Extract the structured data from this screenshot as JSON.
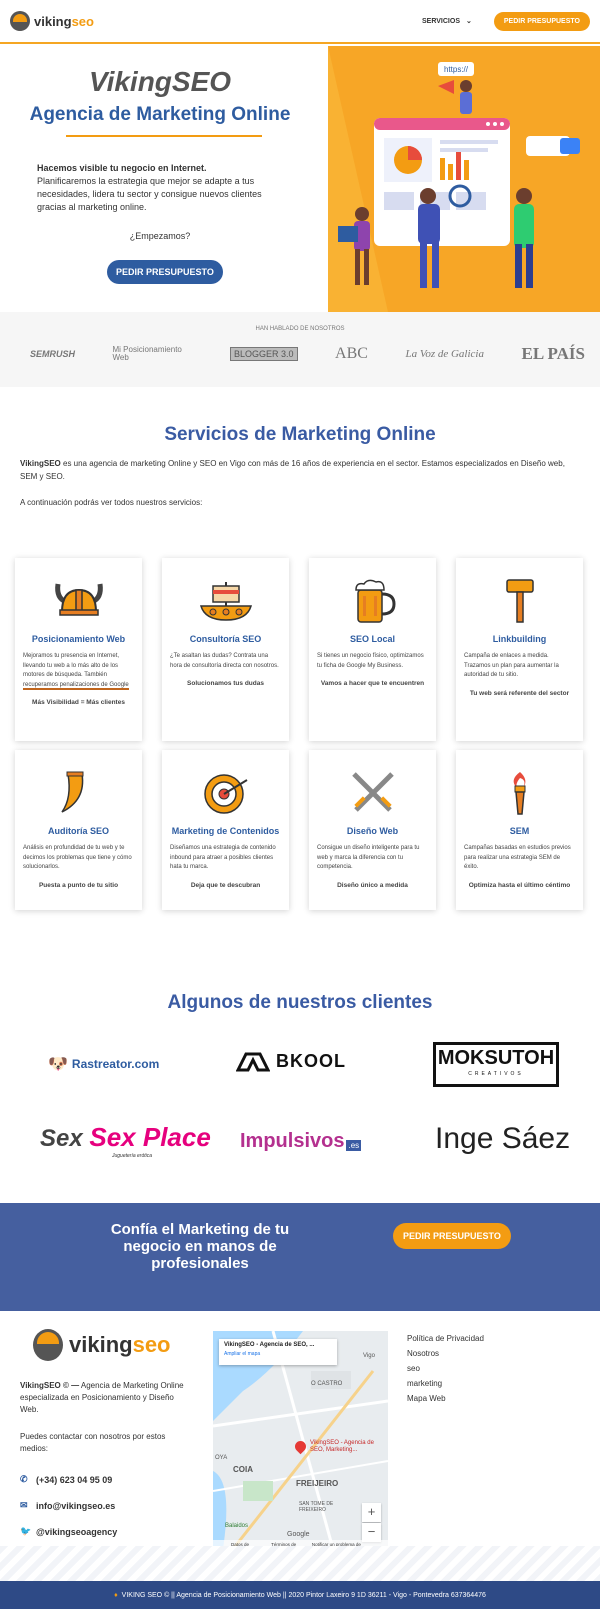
{
  "header": {
    "logo_text_a": "viking",
    "logo_text_b": "seo",
    "nav_servicios": "SERVICIOS",
    "nav_button": "PEDIR PRESUPUESTO"
  },
  "hero": {
    "title": "VikingSEO",
    "subtitle": "Agencia de Marketing Online",
    "lead_bold": "Hacemos visible tu negocio en Internet.",
    "lead": "Planificaremos la estrategia que mejor se adapte a tus necesidades, lidera tu sector y consigue nuevos clientes gracias al marketing online.",
    "question": "¿Empezamos?",
    "button": "PEDIR PRESUPUESTO",
    "art_badge": "https://"
  },
  "press": {
    "label": "HAN HABLADO DE NOSOTROS",
    "logos": [
      "SEMRUSH",
      "Mi Posicionamiento Web",
      "BLOGGER 3.0",
      "ABC",
      "La Voz de Galicia",
      "EL PAÍS"
    ]
  },
  "services": {
    "title": "Servicios de Marketing Online",
    "intro_bold": "VikingSEO",
    "intro": " es una agencia de marketing Online y SEO en Vigo con más de 16 años de experiencia en el sector. Estamos especializados en Diseño web, SEM y SEO.",
    "more": "A continuación podrás ver todos nuestros servicios:",
    "cards": [
      {
        "title": "Posicionamiento Web",
        "desc": "Mejoramos tu presencia en Internet, llevando tu web a lo más alto de los motores de búsqueda. También ",
        "desc_hl": "recuperamos penalizaciones de Google",
        "tag": "Más Visibilidad = Más clientes",
        "icon": "viking-helmet-icon"
      },
      {
        "title": "Consultoría SEO",
        "desc": "¿Te asaltan las dudas? Contrata una hora de consultoría directa con nosotros.",
        "desc_hl": "",
        "tag": "Solucionamos tus dudas",
        "icon": "viking-ship-icon"
      },
      {
        "title": "SEO Local",
        "desc": "Si tienes un negocio físico, optimizamos tu ficha de Google My Business.",
        "desc_hl": "",
        "tag": "Vamos a hacer que te encuentren",
        "icon": "beer-mug-icon"
      },
      {
        "title": "Linkbuilding",
        "desc": "Campaña de enlaces a medida. Trazamos un plan para aumentar la autoridad de tu sitio.",
        "desc_hl": "",
        "tag": "Tu web será referente del sector",
        "icon": "hammer-icon"
      },
      {
        "title": "Auditoría SEO",
        "desc": "Análisis en profundidad de tu web y te decimos los problemas que tiene y cómo solucionarlos.",
        "desc_hl": "",
        "tag": "Puesta a punto de tu sitio",
        "icon": "horn-icon"
      },
      {
        "title": "Marketing de Contenidos",
        "desc": "Diseñamos una estrategia de contenido inbound para atraer a posibles clientes hata tu marca.",
        "desc_hl": "",
        "tag": "Deja que te descubran",
        "icon": "target-icon"
      },
      {
        "title": "Diseño Web",
        "desc": "Consigue un diseño inteligente para tu web y marca la diferencia con tu competencia.",
        "desc_hl": "",
        "tag": "Diseño único a medida",
        "icon": "crossed-swords-icon"
      },
      {
        "title": "SEM",
        "desc": "Campañas basadas en estudios previos para realizar una estrategia SEM de éxito.",
        "desc_hl": "",
        "tag": "Optimiza hasta el último céntimo",
        "icon": "torch-icon"
      }
    ]
  },
  "clients": {
    "title": "Algunos de nuestros clientes",
    "list": [
      "Rastreator.com",
      "BKOOL",
      "MOKSUTOH",
      "CREATIVOS",
      "Sex Place",
      "Juguetería erótica",
      "Impulsivos",
      ".es",
      "Inge Sáez"
    ]
  },
  "cta": {
    "text": "Confía el Marketing de tu negocio en manos de profesionales",
    "button": "PEDIR PRESUPUESTO"
  },
  "footer": {
    "logo_a": "viking",
    "logo_b": "seo",
    "about_bold": "VikingSEO © —",
    "about": " Agencia de Marketing Online especializada en Posicionamiento y Diseño Web.",
    "contact_intro": "Puedes contactar con nosotros por estos medios:",
    "phone": "(+34) 623 04 95 09",
    "email": "info@vikingseo.es",
    "twitter": "@vikingseoagency",
    "links": [
      "Política de Privacidad",
      "Nosotros",
      "seo",
      "marketing",
      "Mapa Web"
    ],
    "map": {
      "card_title": "VikingSEO - Agencia de SEO, ...",
      "card_link": "Ampliar el mapa",
      "place": "VikingSEO - Agencia de SEO, Marketing...",
      "labels": [
        "O CASTRO",
        "COIA",
        "FREIJEIRO",
        "SAN TOME DE FREIXEIRO",
        "Balaidos",
        "Vigo",
        "OYA"
      ],
      "footer_items": [
        "Datos de mapas",
        "Términos de uso",
        "Notificar un problema de Maps"
      ],
      "brand": "Google"
    },
    "bottom": "VIKING SEO © || Agencia de Posicionamiento Web || 2020  Pintor Laxeiro 9 1D 36211 - Vigo - Pontevedra 637364476"
  }
}
